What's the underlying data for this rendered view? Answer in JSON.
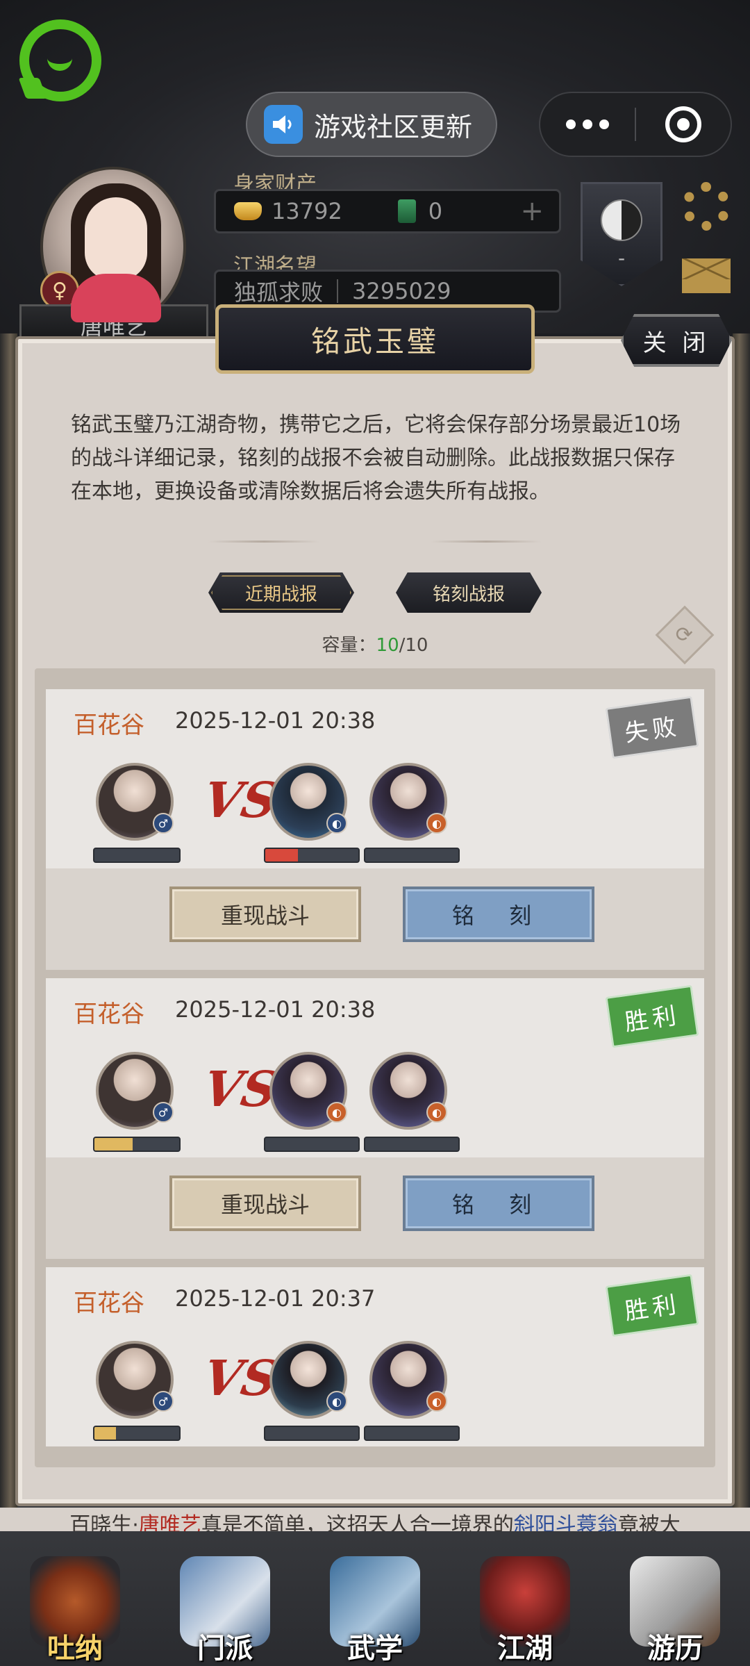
{
  "app": {
    "notice_label": "游戏社区更新"
  },
  "player": {
    "name": "唐唯艺",
    "gender_symbol": "♀",
    "wealth_label": "身家财产",
    "gold": "13792",
    "jade": "0",
    "fame_label": "江湖名望",
    "fame_title": "独孤求败",
    "fame_value": "3295029",
    "banner_value": "-"
  },
  "panel": {
    "title": "铭武玉璧",
    "close_label": "关 闭",
    "description": "铭武玉璧乃江湖奇物，携带它之后，它将会保存部分场景最近10场的战斗详细记录，铭刻的战报不会被自动删除。此战报数据只保存在本地，更换设备或清除数据后将会遗失所有战报。",
    "tabs": [
      {
        "label": "近期战报",
        "active": true
      },
      {
        "label": "铭刻战报",
        "active": false
      }
    ],
    "capacity_label": "容量：",
    "capacity_current": "10",
    "capacity_total": "/10",
    "capacity_color": "#2f9a37"
  },
  "battles": [
    {
      "place": "百花谷",
      "time": "2025-12-01 20:38",
      "result": "失败",
      "result_color": "#7c7c7c",
      "player_hp": 0,
      "enemies": [
        {
          "hp": 0.35,
          "hp_color": "#d8493c"
        },
        {
          "hp": 0
        }
      ],
      "replay_label": "重现战斗",
      "engrave_label": "铭 刻"
    },
    {
      "place": "百花谷",
      "time": "2025-12-01 20:38",
      "result": "胜利",
      "result_color": "#4c9e45",
      "player_hp": 0.45,
      "enemies": [
        {
          "hp": 0
        },
        {
          "hp": 0
        }
      ],
      "replay_label": "重现战斗",
      "engrave_label": "铭 刻"
    },
    {
      "place": "百花谷",
      "time": "2025-12-01 20:37",
      "result": "胜利",
      "result_color": "#4c9e45",
      "player_hp": 0.25,
      "enemies": [
        {
          "hp": 0
        },
        {
          "hp": 0
        }
      ]
    }
  ],
  "vs_label": "VS",
  "ticker": {
    "prefix": "百晓生·",
    "name": "唐唯艺",
    "middle": "真是不简单，这招天人合一境界的",
    "skill": "斜阳斗蓑翁",
    "suffix": "竟被大"
  },
  "nav": [
    {
      "label": "吐纳",
      "active": true
    },
    {
      "label": "门派",
      "active": false
    },
    {
      "label": "武学",
      "active": false
    },
    {
      "label": "江湖",
      "active": false
    },
    {
      "label": "游历",
      "active": false
    }
  ]
}
